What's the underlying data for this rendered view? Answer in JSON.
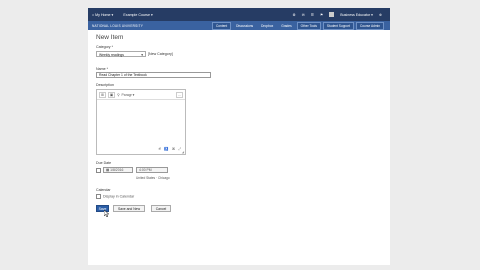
{
  "topbar": {
    "my_home": "My Home",
    "course": "Example Course",
    "user": "Business Educator",
    "colors": {
      "bg": "#263c64"
    }
  },
  "navbar": {
    "brand": "NATIONAL LOUIS UNIVERSITY",
    "items": [
      "Content",
      "Discussions",
      "Dropbox",
      "Grades",
      "Other Tools",
      "Student Support",
      "Course Admin"
    ]
  },
  "form": {
    "title": "New Item",
    "category_label": "Category *",
    "category_value": "Weekly readings",
    "new_category": "[New Category]",
    "name_label": "Name *",
    "name_value": "Read Chapter 1 of the Textbook",
    "description_label": "Description",
    "editor_format": "Paragr",
    "editor_more": "...",
    "due_label": "Due Date",
    "due_date": "1/8/2016",
    "due_time": "4:00 PM",
    "timezone": "United States · Chicago",
    "calendar_label": "Calendar",
    "calendar_option": "Display in Calendar",
    "save": "Save",
    "save_new": "Save and New",
    "cancel": "Cancel"
  }
}
